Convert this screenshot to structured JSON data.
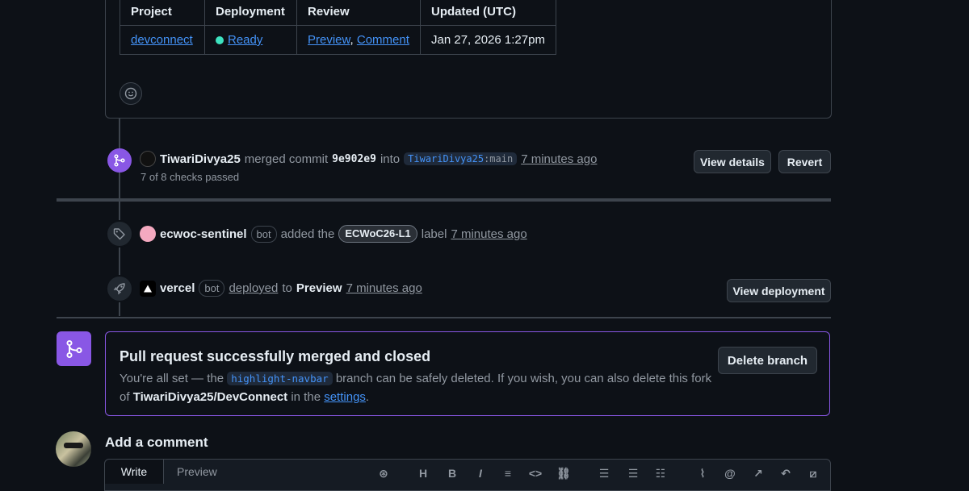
{
  "deploy_table": {
    "headers": [
      "Project",
      "Deployment",
      "Review",
      "Updated (UTC)"
    ],
    "row": {
      "project": "devconnect",
      "deployment": "Ready",
      "review_preview": "Preview",
      "review_sep": ",",
      "review_comment": "Comment",
      "updated": "Jan 27, 2026 1:27pm"
    }
  },
  "merge_event": {
    "user": "TiwariDivya25",
    "text_merged": "merged commit",
    "commit": "9e902e9",
    "text_into": "into",
    "branch_user": "TiwariDivya25",
    "branch_name": ":main",
    "time": "7 minutes ago",
    "checks": "7 of 8 checks passed",
    "view_details": "View details",
    "revert": "Revert"
  },
  "label_event": {
    "user": "ecwoc-sentinel",
    "bot": "bot",
    "text_added": "added the",
    "label": "ECWoC26-L1",
    "text_label": "label",
    "time": "7 minutes ago"
  },
  "deploy_event": {
    "user": "vercel",
    "bot": "bot",
    "deployed": "deployed",
    "to": "to",
    "env": "Preview",
    "time": "7 minutes ago",
    "view_deployment": "View deployment"
  },
  "merged_box": {
    "title": "Pull request successfully merged and closed",
    "line1_a": "You're all set — the",
    "branch": "highlight-navbar",
    "line1_b": "branch can be safely deleted. If you wish, you can also delete this fork",
    "line2_a": "of",
    "repo": "TiwariDivya25/DevConnect",
    "line2_b": "in the",
    "settings": "settings",
    "line2_c": ".",
    "delete_branch": "Delete branch"
  },
  "add_comment": {
    "title": "Add a comment",
    "tab_write": "Write",
    "tab_preview": "Preview",
    "toolbar": [
      "copilot-icon",
      "heading-icon",
      "bold-icon",
      "italic-icon",
      "quote-icon",
      "code-icon",
      "link-icon",
      "ordered-list-icon",
      "unordered-list-icon",
      "task-list-icon",
      "attach-icon",
      "mention-icon",
      "reference-icon",
      "undo-icon",
      "slash-icon"
    ]
  },
  "colors": {
    "background": "#0d1117",
    "merged_purple": "#8957e5",
    "link_blue": "#4493f8",
    "ready_green": "#3ee3c0"
  }
}
